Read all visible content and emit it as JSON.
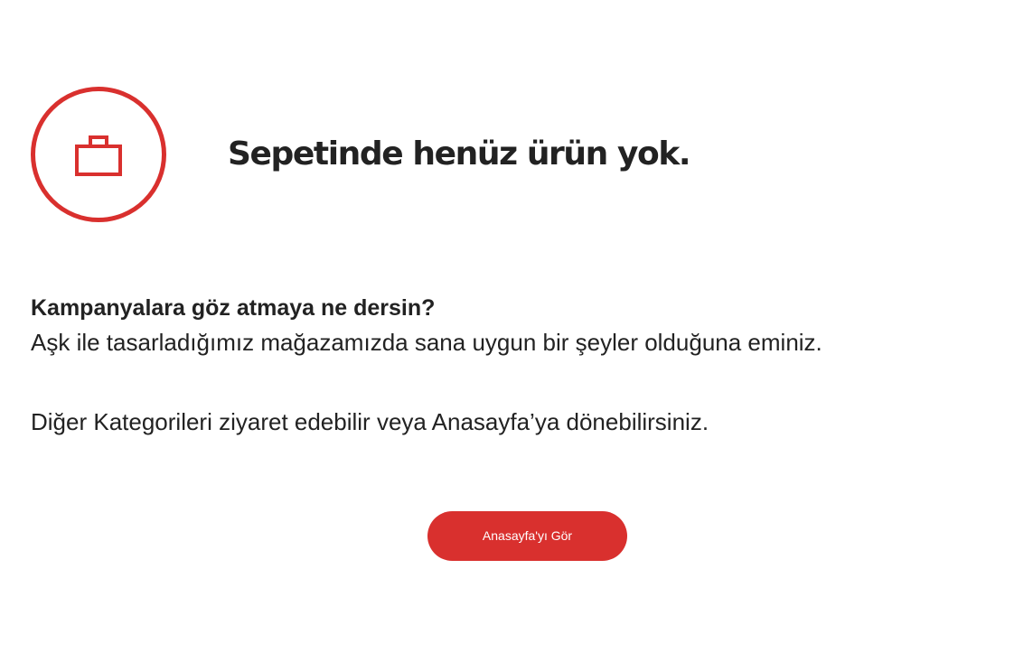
{
  "empty_cart": {
    "title": "Sepetinde henüz ürün yok.",
    "icon": "shopping-bag-icon",
    "accent_color": "#d9302e"
  },
  "message": {
    "heading": "Kampanyalara göz atmaya ne dersin?",
    "line1": "Aşk ile tasarladığımız mağazamızda sana uygun bir şeyler olduğuna eminiz.",
    "line2": "Diğer Kategorileri ziyaret edebilir veya Anasayfa’ya dönebilirsiniz."
  },
  "actions": {
    "home_button_label": "Anasayfa'yı Gör"
  }
}
